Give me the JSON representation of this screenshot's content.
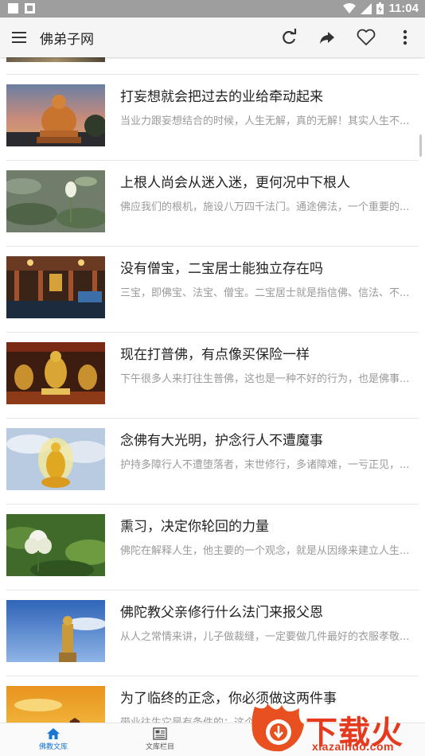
{
  "status_bar": {
    "time": "11:04"
  },
  "app_bar": {
    "title": "佛弟子网",
    "icons": [
      "menu-icon",
      "refresh-icon",
      "share-icon",
      "heart-icon",
      "more-vertical-icon"
    ]
  },
  "articles": [
    {
      "title": "打妄想就会把过去的业给牵动起来",
      "summary": "当业力跟妄想结合的时候，人生无解，真的无解！其实人生不...",
      "image": "buddha-statue-sunset"
    },
    {
      "title": "上根人尚会从迷入迷，更何况中下根人",
      "summary": "佛应我们的根机，施设八万四千法门。通途佛法，一个重要的...",
      "image": "lotus-bud-pond"
    },
    {
      "title": "没有僧宝，二宝居士能独立存在吗",
      "summary": "三宝，即佛宝、法宝、僧宝。二宝居士就是指信佛、信法、不...",
      "image": "temple-hall-assembly"
    },
    {
      "title": "现在打普佛，有点像买保险一样",
      "summary": "下午很多人来打往生普佛，这也是一种不好的行为，也是佛事...",
      "image": "golden-buddhas-altar"
    },
    {
      "title": "念佛有大光明，护念行人不遭魔事",
      "summary": "护持多障行人不遭堕落者，末世修行，多诸障难，一亏正见，...",
      "image": "golden-buddha-sky"
    },
    {
      "title": "熏习，决定你轮回的力量",
      "summary": "佛陀在解释人生，他主要的一个观念，就是从因缘来建立人生...",
      "image": "white-lotus-leaves"
    },
    {
      "title": "佛陀教父亲修行什么法门来报父恩",
      "summary": "从人之常情来讲，儿子做裁缝，一定要做几件最好的衣服孝敬...",
      "image": "giant-buddha-blue-sky"
    },
    {
      "title": "为了临终的正念，你必须做这两件事",
      "summary": "带业往生它是有条件的：这个条件...",
      "image": "orange-sky-silhouette"
    }
  ],
  "bottom_nav": [
    {
      "label": "佛教文库",
      "icon": "home-icon",
      "active": true
    },
    {
      "label": "文库栏目",
      "icon": "newspaper-icon",
      "active": false
    }
  ],
  "watermark": {
    "text": "下载火",
    "url": "xiazaihuo.com"
  },
  "colors": {
    "accent": "#1976d2",
    "app_bar": "#f5f5f5",
    "watermark": "#e53a1e"
  }
}
